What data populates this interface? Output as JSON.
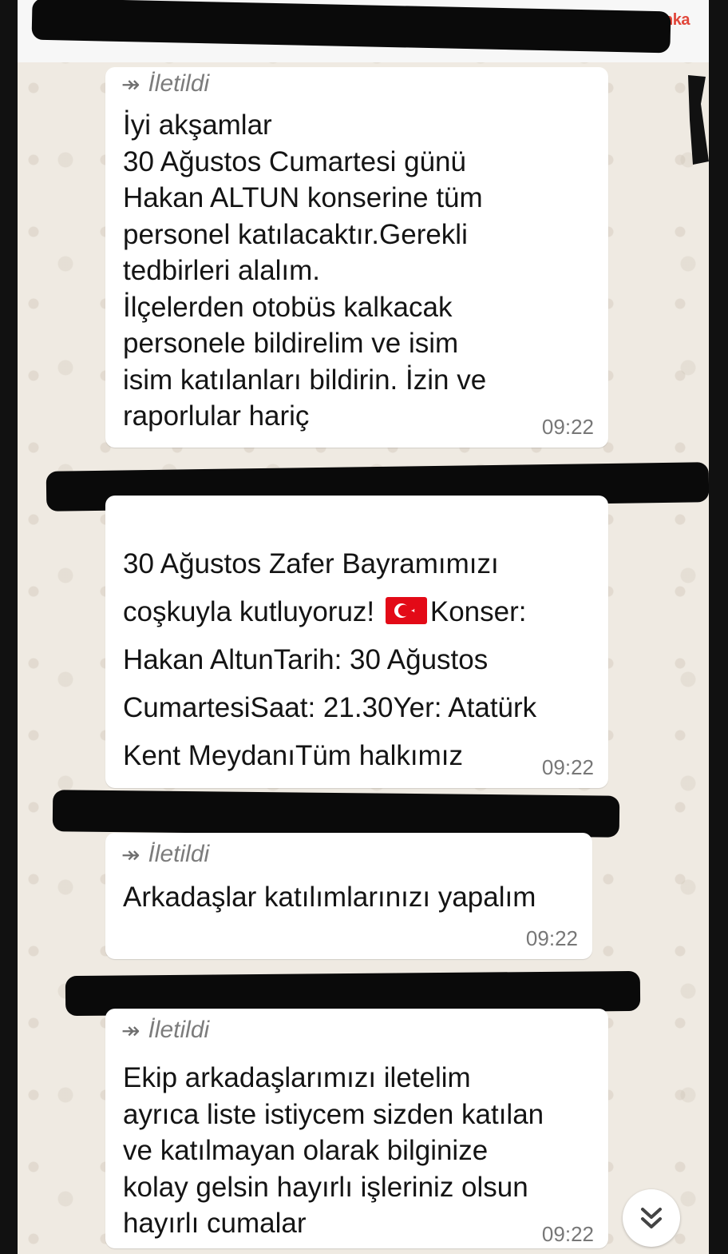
{
  "brand": {
    "logo_text": "anka",
    "logo_color": "#e1463a"
  },
  "messages": [
    {
      "forwarded": true,
      "forwarded_label": "İletildi",
      "text": "İyi akşamlar\n30 Ağustos Cumartesi günü\nHakan ALTUN konserine tüm\npersonel katılacaktır.Gerekli\ntedbirleri alalım.\nİlçelerden otobüs kalkacak\npersonele bildirelim ve isim\nisim katılanları bildirin. İzin ve\nraporlular hariç",
      "time": "09:22"
    },
    {
      "forwarded": true,
      "text_part1": "30 Ağustos Zafer Bayramımızı\ncoşkuyla kutluyoruz! ",
      "flag_icon": "turkey-flag-icon",
      "text_part2": "Konser:\nHakan AltunTarih: 30 Ağustos\nCumartesiSaat: 21.30Yer: Atatürk\nKent MeydanıTüm halkımız\ndavetlidir.",
      "time": "09:22"
    },
    {
      "forwarded": true,
      "forwarded_label": "İletildi",
      "text": "Arkadaşlar katılımlarınızı yapalım",
      "time": "09:22"
    },
    {
      "forwarded": true,
      "forwarded_label": "İletildi",
      "text": "Ekip arkadaşlarımızı iletelim\nayrıca liste istiycem sizden katılan\nve katılmayan olarak bilginize\nkolay gelsin hayırlı işleriniz olsun\nhayırlı cumalar",
      "time": "09:22"
    }
  ],
  "scroll_button_icon": "double-chevron-down-icon",
  "colors": {
    "chat_bg": "#efeae2",
    "bubble_bg": "#ffffff",
    "redaction": "#0a0a0a",
    "flag_red": "#e30a17"
  }
}
